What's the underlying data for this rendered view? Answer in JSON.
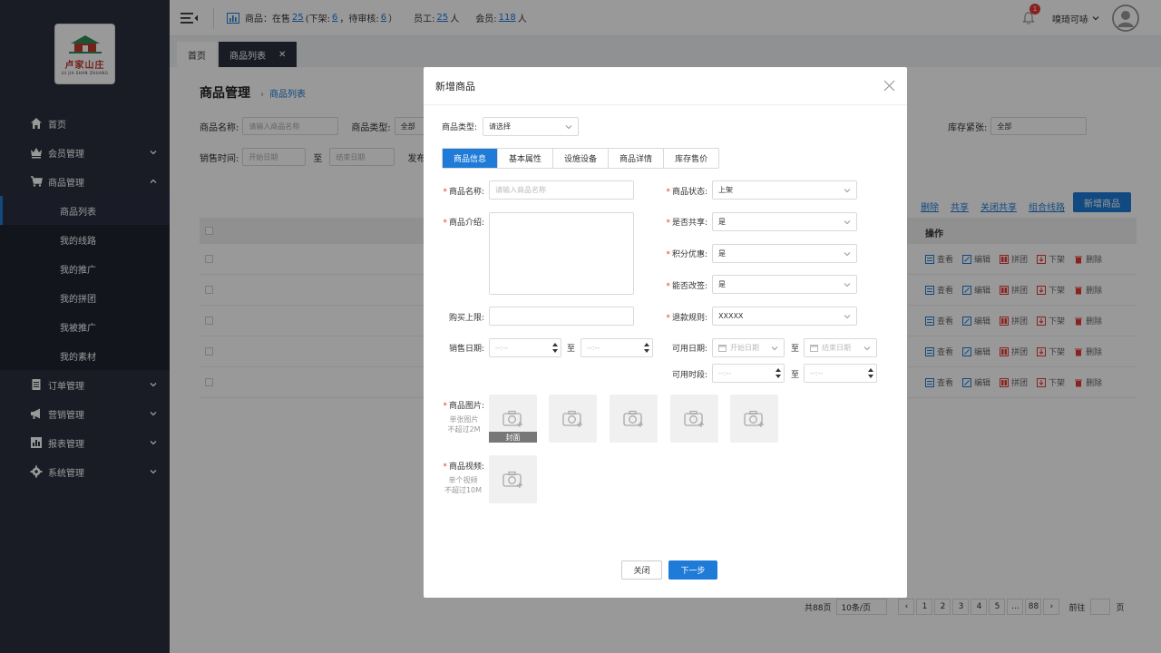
{
  "logo": {
    "title": "卢家山庄",
    "subtitle": "LU JIA SHAN ZHUANG"
  },
  "sidebar": {
    "items": [
      {
        "label": "首页",
        "icon": "home-icon"
      },
      {
        "label": "会员管理",
        "icon": "crown-icon"
      },
      {
        "label": "商品管理",
        "icon": "cart-icon"
      },
      {
        "label": "订单管理",
        "icon": "order-icon"
      },
      {
        "label": "营销管理",
        "icon": "megaphone-icon"
      },
      {
        "label": "报表管理",
        "icon": "chart-icon"
      },
      {
        "label": "系统管理",
        "icon": "gear-icon"
      }
    ],
    "submenu": [
      "商品列表",
      "我的线路",
      "我的推广",
      "我的拼团",
      "我被推广",
      "我的素材"
    ]
  },
  "header": {
    "goods_label": "商品：在售",
    "on_sale": "25",
    "off_label": "(下架:",
    "off_shelf": "6",
    "pending_label": "，待审核:",
    "pending": "6",
    "close_paren": "）",
    "staff_label": "员工:",
    "staff": "25",
    "unit_person": "人",
    "member_label": "会员:",
    "members": "118",
    "notification_count": "1",
    "user_name": "嗅琦可哧"
  },
  "tabs": [
    {
      "label": "首页"
    },
    {
      "label": "商品列表"
    }
  ],
  "page": {
    "title": "商品管理",
    "breadcrumb": "商品列表",
    "filters": {
      "name_label": "商品名称:",
      "name_placeholder": "请输入商品名称",
      "type_label": "商品类型:",
      "type_value": "全部",
      "stock_label": "库存紧张:",
      "stock_value": "全部",
      "sale_time_label": "销售时间:",
      "start_placeholder": "开始日期",
      "to": "至",
      "end_placeholder": "结束日期",
      "publish_label": "发布"
    },
    "links": [
      "删除",
      "共享",
      "关闭共享",
      "组合线路"
    ],
    "add_button": "新增商品",
    "table_ops_header": "操作",
    "row_ops": [
      "查看",
      "编辑",
      "拼团",
      "下架",
      "删除"
    ],
    "pagination": {
      "total": "共88页",
      "per_page": "10条/页",
      "pages": [
        "1",
        "2",
        "3",
        "4",
        "5",
        "...",
        "88"
      ],
      "goto": "前往",
      "page_unit": "页"
    }
  },
  "modal": {
    "title": "新增商品",
    "type_label": "商品类型:",
    "type_placeholder": "请选择",
    "tabs": [
      "商品信息",
      "基本属性",
      "设施设备",
      "商品详情",
      "库存售价"
    ],
    "fields": {
      "name_label": "商品名称:",
      "name_placeholder": "请输入商品名称",
      "intro_label": "商品介绍:",
      "limit_label": "购买上限:",
      "sale_date_label": "销售日期:",
      "time_placeholder": "--:--",
      "to": "至",
      "status_label": "商品状态:",
      "status_value": "上架",
      "share_label": "是否共享:",
      "share_value": "是",
      "points_label": "积分优惠:",
      "points_value": "是",
      "sign_label": "能否改签:",
      "sign_value": "是",
      "refund_label": "退款规则:",
      "refund_value": "XXXXX",
      "avail_date_label": "可用日期:",
      "start_placeholder": "开始日期",
      "end_placeholder": "结束日期",
      "avail_time_label": "可用时段:",
      "image_label": "商品图片:",
      "image_hint_1": "单张图片",
      "image_hint_2": "不超过2M",
      "cover_label": "封面",
      "video_label": "商品视频:",
      "video_hint_1": "单个视频",
      "video_hint_2": "不超过10M"
    },
    "close_button": "关闭",
    "next_button": "下一步"
  }
}
